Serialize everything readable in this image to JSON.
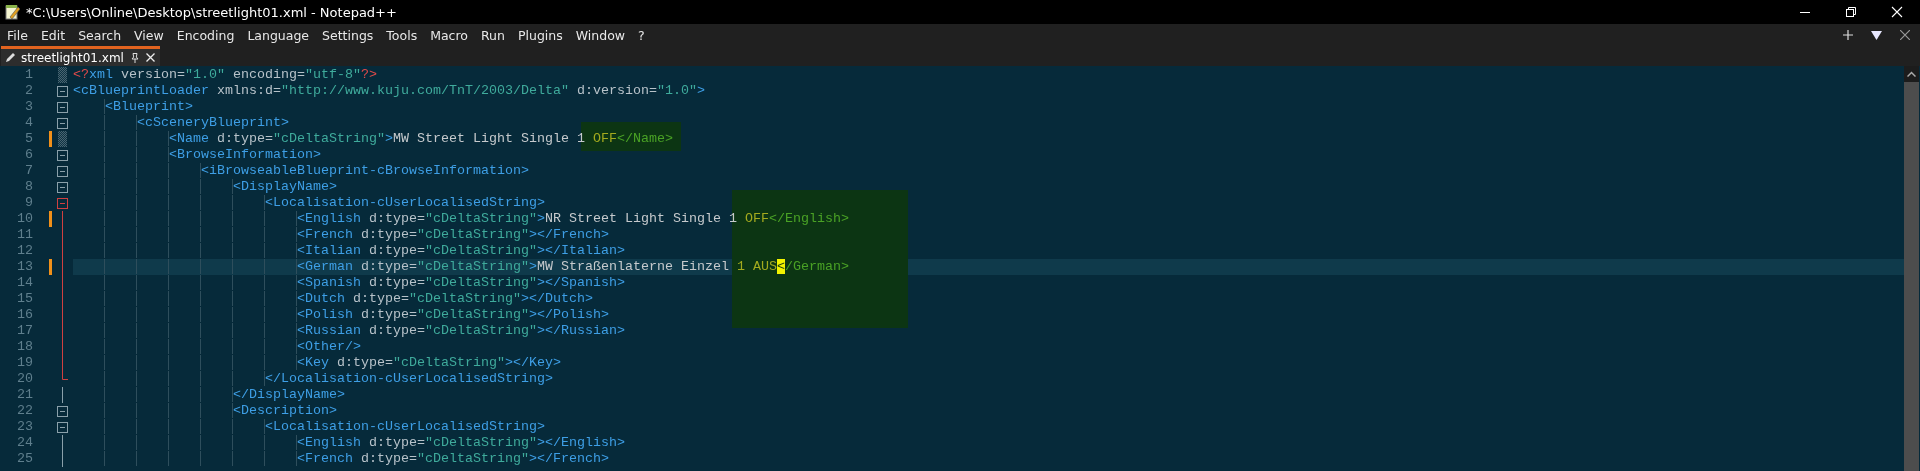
{
  "window": {
    "title": "*C:\\Users\\Online\\Desktop\\streetlight01.xml - Notepad++"
  },
  "menu": [
    "File",
    "Edit",
    "Search",
    "View",
    "Encoding",
    "Language",
    "Settings",
    "Tools",
    "Macro",
    "Run",
    "Plugins",
    "Window",
    "?"
  ],
  "tabs": [
    {
      "label": "streetlight01.xml",
      "selected": true,
      "modified": true
    }
  ],
  "editor": {
    "lines": [
      {
        "number": "1",
        "segments": [
          {
            "kind": "code",
            "text": "<?xml version=\"1.0\" encoding=\"utf-8\"?>"
          }
        ],
        "changed": false,
        "current": false,
        "kind": "plain"
      },
      {
        "number": "2",
        "segments": [
          {
            "kind": "code",
            "text": "<cBlueprintLoader xmlns:d=\"http://www.kuju.com/TnT/2003/Delta\" d:version=\"1.0\">"
          }
        ],
        "changed": false,
        "current": false,
        "kind": "open"
      },
      {
        "number": "3",
        "segments": [
          {
            "kind": "code",
            "text": "    <Blueprint>"
          }
        ],
        "changed": false,
        "current": false,
        "kind": "open"
      },
      {
        "number": "4",
        "segments": [
          {
            "kind": "code",
            "text": "        <cSceneryBlueprint>"
          }
        ],
        "changed": false,
        "current": false,
        "kind": "open"
      },
      {
        "number": "5",
        "segments": [
          {
            "kind": "code",
            "text": "            <Name d:type=\"cDeltaString\">MW Street Light Single 1 "
          },
          {
            "kind": "mark",
            "text": "OFF"
          },
          {
            "kind": "mark-tag",
            "text": "</Name>"
          }
        ],
        "changed": true,
        "current": false,
        "kind": "plain"
      },
      {
        "number": "6",
        "segments": [
          {
            "kind": "code",
            "text": "            <BrowseInformation>"
          }
        ],
        "changed": false,
        "current": false,
        "kind": "open"
      },
      {
        "number": "7",
        "segments": [
          {
            "kind": "code",
            "text": "                <iBrowseableBlueprint-cBrowseInformation>"
          }
        ],
        "changed": false,
        "current": false,
        "kind": "open"
      },
      {
        "number": "8",
        "segments": [
          {
            "kind": "code",
            "text": "                    <DisplayName>"
          }
        ],
        "changed": false,
        "current": false,
        "kind": "open"
      },
      {
        "number": "9",
        "segments": [
          {
            "kind": "code",
            "text": "                        <Localisation-cUserLocalisedString>"
          }
        ],
        "changed": false,
        "current": false,
        "kind": "open-active"
      },
      {
        "number": "10",
        "segments": [
          {
            "kind": "code",
            "text": "                            <English d:type=\"cDeltaString\">NR Street Light Single 1 "
          },
          {
            "kind": "mark",
            "text": "OFF"
          },
          {
            "kind": "mark-tag",
            "text": "</English>"
          }
        ],
        "changed": true,
        "current": false,
        "kind": "line-active"
      },
      {
        "number": "11",
        "segments": [
          {
            "kind": "code",
            "text": "                            <French d:type=\"cDeltaString\"></French>"
          }
        ],
        "changed": false,
        "current": false,
        "kind": "line-active"
      },
      {
        "number": "12",
        "segments": [
          {
            "kind": "code",
            "text": "                            <Italian d:type=\"cDeltaString\"></Italian>"
          }
        ],
        "changed": false,
        "current": false,
        "kind": "line-active"
      },
      {
        "number": "13",
        "segments": [
          {
            "kind": "code",
            "text": "                            <German d:type=\"cDeltaString\">MW Straßenlaterne Einzel "
          },
          {
            "kind": "mark",
            "text": "1 AUS"
          },
          {
            "kind": "caret",
            "text": "<"
          },
          {
            "kind": "mark-tag",
            "text": "/German>"
          }
        ],
        "changed": true,
        "current": true,
        "kind": "line-active"
      },
      {
        "number": "14",
        "segments": [
          {
            "kind": "code",
            "text": "                            <Spanish d:type=\"cDeltaString\"></Spanish>"
          }
        ],
        "changed": false,
        "current": false,
        "kind": "line-active"
      },
      {
        "number": "15",
        "segments": [
          {
            "kind": "code",
            "text": "                            <Dutch d:type=\"cDeltaString\"></Dutch>"
          }
        ],
        "changed": false,
        "current": false,
        "kind": "line-active"
      },
      {
        "number": "16",
        "segments": [
          {
            "kind": "code",
            "text": "                            <Polish d:type=\"cDeltaString\"></Polish>"
          }
        ],
        "changed": false,
        "current": false,
        "kind": "line-active"
      },
      {
        "number": "17",
        "segments": [
          {
            "kind": "code",
            "text": "                            <Russian d:type=\"cDeltaString\"></Russian>"
          }
        ],
        "changed": false,
        "current": false,
        "kind": "line-active"
      },
      {
        "number": "18",
        "segments": [
          {
            "kind": "code",
            "text": "                            <Other/>"
          }
        ],
        "changed": false,
        "current": false,
        "kind": "line-active"
      },
      {
        "number": "19",
        "segments": [
          {
            "kind": "code",
            "text": "                            <Key d:type=\"cDeltaString\"></Key>"
          }
        ],
        "changed": false,
        "current": false,
        "kind": "line-active"
      },
      {
        "number": "20",
        "segments": [
          {
            "kind": "code",
            "text": "                        </Localisation-cUserLocalisedString>"
          }
        ],
        "changed": false,
        "current": false,
        "kind": "end-active"
      },
      {
        "number": "21",
        "segments": [
          {
            "kind": "code",
            "text": "                    </DisplayName>"
          }
        ],
        "changed": false,
        "current": false,
        "kind": "line"
      },
      {
        "number": "22",
        "segments": [
          {
            "kind": "code",
            "text": "                    <Description>"
          }
        ],
        "changed": false,
        "current": false,
        "kind": "open"
      },
      {
        "number": "23",
        "segments": [
          {
            "kind": "code",
            "text": "                        <Localisation-cUserLocalisedString>"
          }
        ],
        "changed": false,
        "current": false,
        "kind": "open"
      },
      {
        "number": "24",
        "segments": [
          {
            "kind": "code",
            "text": "                            <English d:type=\"cDeltaString\"></English>"
          }
        ],
        "changed": false,
        "current": false,
        "kind": "line"
      },
      {
        "number": "25",
        "segments": [
          {
            "kind": "code",
            "text": "                            <French d:type=\"cDeltaString\"></French>"
          }
        ],
        "changed": false,
        "current": false,
        "kind": "line"
      }
    ]
  }
}
